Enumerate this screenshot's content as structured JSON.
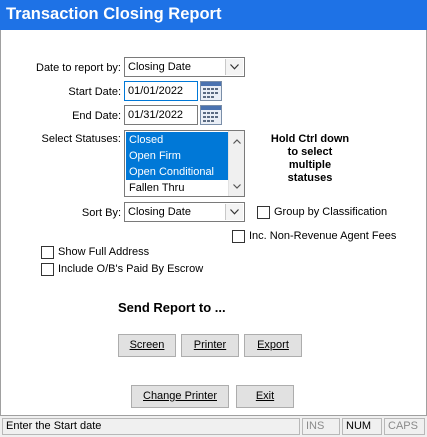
{
  "window": {
    "title": "Transaction Closing Report"
  },
  "form": {
    "date_report_label": "Date to report by:",
    "date_report_value": "Closing Date",
    "start_date_label": "Start Date:",
    "start_date_value": "01/01/2022",
    "end_date_label": "End Date:",
    "end_date_value": "01/31/2022",
    "statuses_label": "Select Statuses:",
    "statuses": [
      {
        "label": "Closed",
        "selected": true
      },
      {
        "label": "Open Firm",
        "selected": true
      },
      {
        "label": "Open Conditional",
        "selected": true
      },
      {
        "label": "Fallen Thru",
        "selected": false
      }
    ],
    "statuses_hint": "Hold Ctrl down\nto select\nmultiple\nstatuses",
    "sort_by_label": "Sort By:",
    "sort_by_value": "Closing Date",
    "group_by_label": "Group by Classification",
    "group_by_checked": false,
    "non_revenue_label": "Inc. Non-Revenue Agent Fees",
    "non_revenue_checked": false,
    "show_address_label": "Show Full Address",
    "show_address_checked": false,
    "include_ob_label": "Include O/B's Paid By Escrow",
    "include_ob_checked": false
  },
  "send": {
    "heading": "Send Report to ...",
    "screen": "Screen",
    "printer": "Printer",
    "export": "Export",
    "change_printer": "Change Printer",
    "exit": "Exit"
  },
  "statusbar": {
    "message": "Enter the Start date",
    "ins": "INS",
    "num": "NUM",
    "caps": "CAPS"
  },
  "colors": {
    "title_bar": "#1e72e6",
    "selection": "#0078d7"
  },
  "icons": {
    "calendar": "calendar-icon",
    "dropdown": "chevron-down-icon"
  }
}
